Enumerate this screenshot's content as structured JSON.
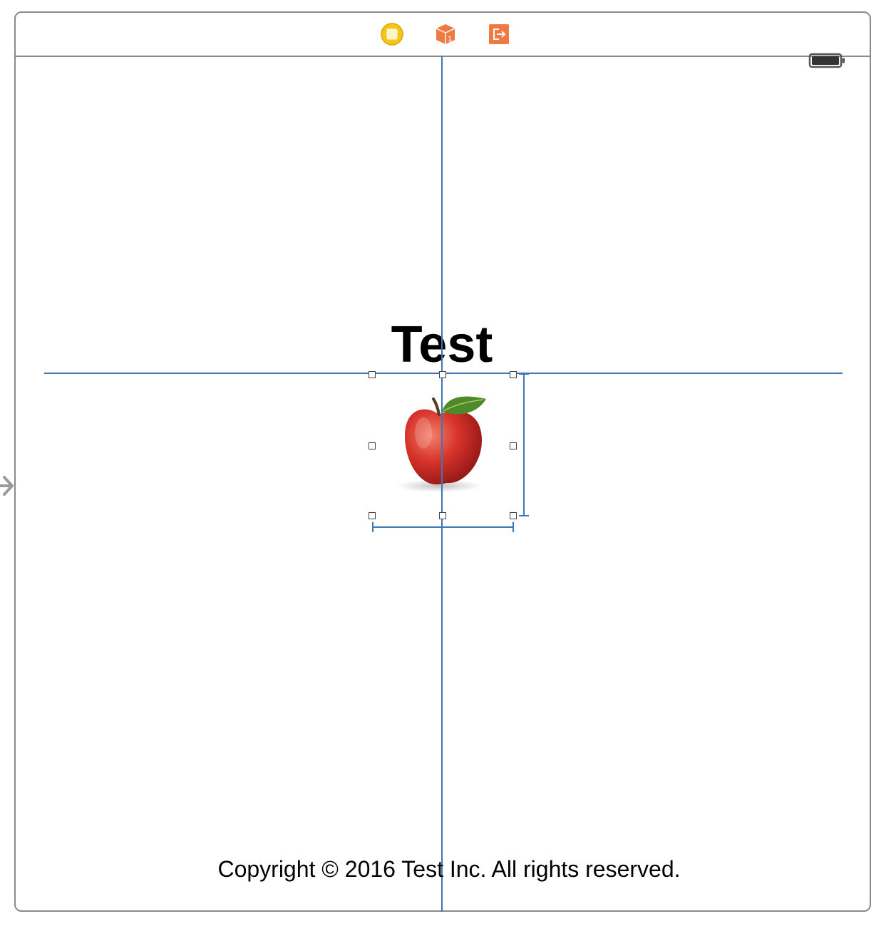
{
  "scene": {
    "dock": {
      "icons": [
        "view-controller-icon",
        "first-responder-icon",
        "exit-icon"
      ],
      "first_responder_badge": "1"
    },
    "status_bar": {
      "icon": "battery-icon"
    },
    "title_label": "Test",
    "image": {
      "icon": "apple-image"
    },
    "copyright_label": "Copyright © 2016 Test Inc. All rights reserved."
  },
  "colors": {
    "guide": "#3b78b8",
    "view_controller": "#f5c518",
    "first_responder": "#ef7b43",
    "exit": "#ef7b43",
    "border": "#8a8a8a"
  }
}
